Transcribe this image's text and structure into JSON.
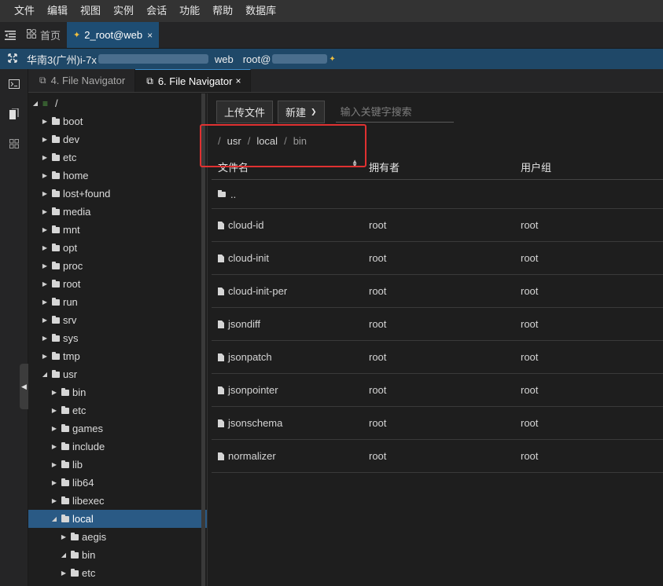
{
  "menu": [
    "文件",
    "编辑",
    "视图",
    "实例",
    "会话",
    "功能",
    "帮助",
    "数据库"
  ],
  "tabs": {
    "home": "首页",
    "session": "2_root@web",
    "close": "×"
  },
  "session_bar": {
    "region": "华南3(广州)i-7x",
    "host_label": "web",
    "user_label": "root@"
  },
  "panel_tabs": [
    {
      "label": "4. File Navigator",
      "active": false
    },
    {
      "label": "6. File Navigator",
      "active": true
    }
  ],
  "tree": {
    "root": "/",
    "items": [
      {
        "label": "boot"
      },
      {
        "label": "dev"
      },
      {
        "label": "etc"
      },
      {
        "label": "home"
      },
      {
        "label": "lost+found"
      },
      {
        "label": "media"
      },
      {
        "label": "mnt"
      },
      {
        "label": "opt"
      },
      {
        "label": "proc"
      },
      {
        "label": "root"
      },
      {
        "label": "run"
      },
      {
        "label": "srv"
      },
      {
        "label": "sys"
      },
      {
        "label": "tmp"
      },
      {
        "label": "usr"
      }
    ],
    "usr_children": [
      {
        "label": "bin"
      },
      {
        "label": "etc"
      },
      {
        "label": "games"
      },
      {
        "label": "include"
      },
      {
        "label": "lib"
      },
      {
        "label": "lib64"
      },
      {
        "label": "libexec"
      },
      {
        "label": "local"
      }
    ],
    "local_children": [
      {
        "label": "aegis"
      },
      {
        "label": "bin"
      },
      {
        "label": "etc"
      }
    ]
  },
  "toolbar": {
    "upload": "上传文件",
    "new": "新建",
    "search_placeholder": "输入关键字搜索"
  },
  "breadcrumb": [
    "usr",
    "local",
    "bin"
  ],
  "table": {
    "headers": {
      "name": "文件名",
      "owner": "拥有者",
      "group": "用户组"
    },
    "parent": "..",
    "rows": [
      {
        "name": "cloud-id",
        "owner": "root",
        "group": "root"
      },
      {
        "name": "cloud-init",
        "owner": "root",
        "group": "root"
      },
      {
        "name": "cloud-init-per",
        "owner": "root",
        "group": "root"
      },
      {
        "name": "jsondiff",
        "owner": "root",
        "group": "root"
      },
      {
        "name": "jsonpatch",
        "owner": "root",
        "group": "root"
      },
      {
        "name": "jsonpointer",
        "owner": "root",
        "group": "root"
      },
      {
        "name": "jsonschema",
        "owner": "root",
        "group": "root"
      },
      {
        "name": "normalizer",
        "owner": "root",
        "group": "root"
      }
    ]
  },
  "colors": {
    "accent": "#1e4d73",
    "selected": "#2a5a85",
    "highlight": "#e03131"
  }
}
